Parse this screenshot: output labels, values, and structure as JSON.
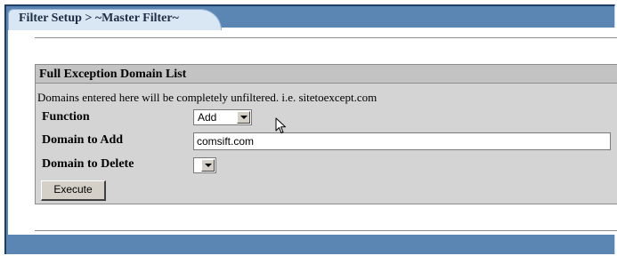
{
  "tab": {
    "label": "Filter Setup > ~Master Filter~"
  },
  "section": {
    "title": "Full Exception Domain List",
    "description": "Domains entered here will be completely unfiltered. i.e. sitetoexcept.com"
  },
  "form": {
    "function": {
      "label": "Function",
      "value": "Add"
    },
    "domain_to_add": {
      "label": "Domain to Add",
      "value": "comsift.com"
    },
    "domain_to_delete": {
      "label": "Domain to Delete",
      "value": ""
    },
    "execute_label": "Execute"
  },
  "colors": {
    "frame": "#5b86b4",
    "tab": "#d9e7f5",
    "section_bg": "#d4d4d4",
    "section_header": "#c3c3c3"
  },
  "icons": {
    "pointer": "mouse-pointer-icon",
    "dropdown": "chevron-down-icon"
  }
}
